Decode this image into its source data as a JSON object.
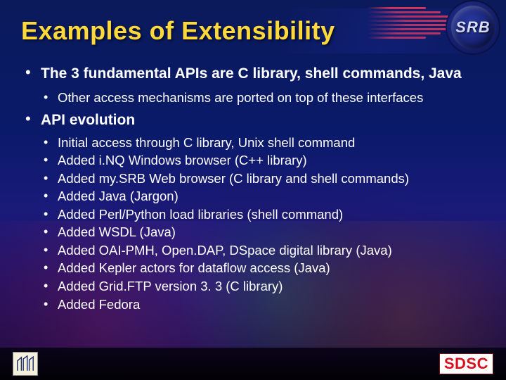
{
  "title": "Examples of Extensibility",
  "badge": "SRB",
  "bullets": {
    "b1": {
      "text": "The 3 fundamental APIs are C library, shell commands, Java",
      "sub": [
        "Other access mechanisms are ported on top of these interfaces"
      ]
    },
    "b2": {
      "text": "API evolution",
      "sub": [
        "Initial access through C library, Unix shell command",
        "Added i.NQ Windows browser (C++ library)",
        "Added my.SRB Web browser (C library and shell commands)",
        "Added Java (Jargon)",
        "Added Perl/Python load libraries (shell command)",
        "Added WSDL (Java)",
        "Added OAI-PMH, Open.DAP, DSpace digital library (Java)",
        "Added Kepler actors for dataflow access (Java)",
        "Added Grid.FTP version 3. 3 (C library)",
        "Added Fedora"
      ]
    }
  },
  "footer": {
    "left_logo": "UCSD",
    "right_logo": "SDSC"
  }
}
